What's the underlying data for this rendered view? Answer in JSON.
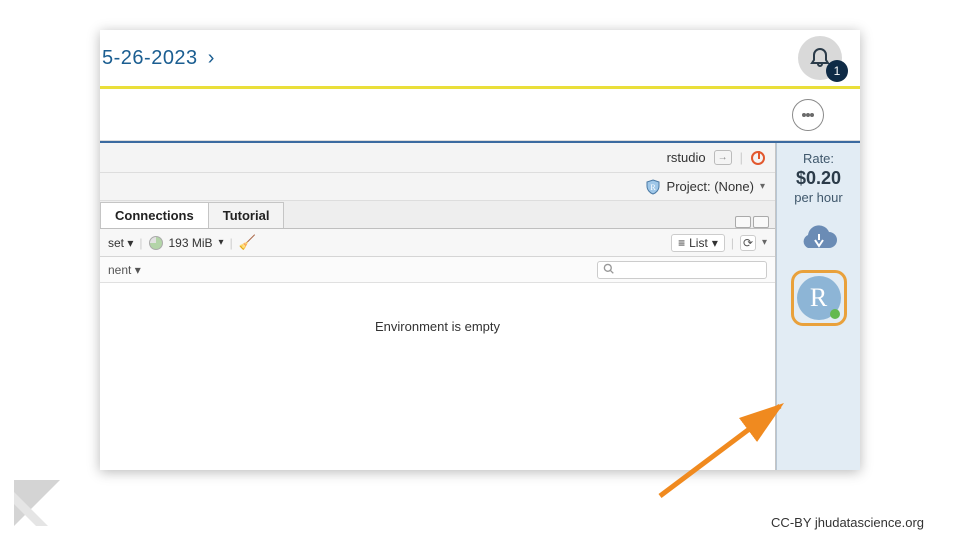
{
  "breadcrumb": {
    "text": "5-26-2023",
    "chevron": "›"
  },
  "notifications": {
    "count": "1"
  },
  "rstudio": {
    "user": "rstudio",
    "project_label": "Project: (None)",
    "tabs": {
      "connections": "Connections",
      "tutorial": "Tutorial"
    },
    "toolbar": {
      "dataset_partial": "set",
      "mem": "193 MiB",
      "list_label": "List",
      "env_partial": "nent",
      "search_placeholder": ""
    },
    "empty_message": "Environment is empty"
  },
  "rail": {
    "rate_label": "Rate:",
    "rate_amount": "$0.20",
    "rate_unit": "per hour",
    "r_letter": "R"
  },
  "attribution": "CC-BY  jhudatascience.org"
}
